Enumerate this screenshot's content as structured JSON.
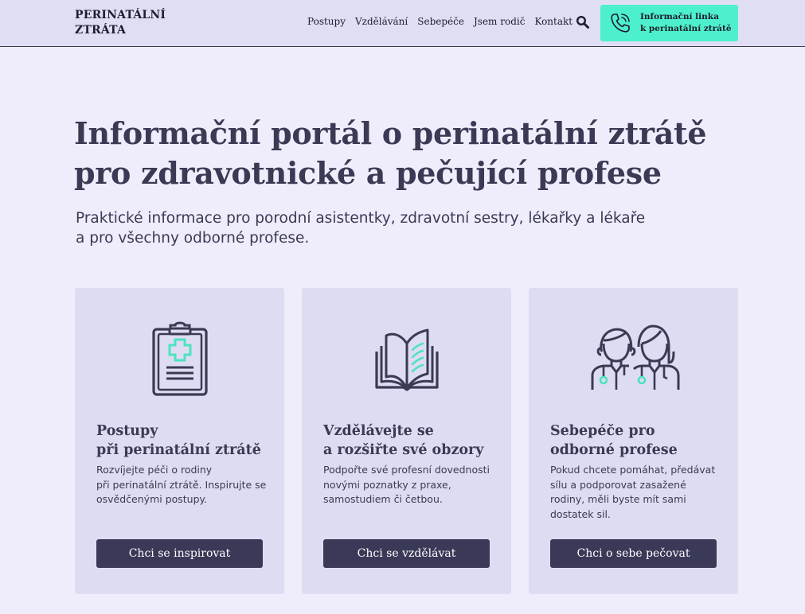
{
  "header": {
    "logo_line1": "PERINATÁLNÍ",
    "logo_line2": "ZTRÁTA",
    "nav": [
      "Postupy",
      "Vzdělávání",
      "Sebepéče",
      "Jsem rodič",
      "Kontakt"
    ],
    "search_icon": "search-icon",
    "helpline_icon": "phone-icon",
    "helpline_line1": "Informační linka",
    "helpline_line2": "k perinatální ztrátě"
  },
  "hero": {
    "title_line1": "Informační portál o perinatální ztrátě",
    "title_line2": "pro zdravotnické a pečující profese",
    "subtitle_line1": "Praktické informace pro porodní asistentky, zdravotní sestry, lékařky a lékaře",
    "subtitle_line2": "a pro všechny odborné profese."
  },
  "cards": [
    {
      "icon": "clipboard-icon",
      "title_line1": "Postupy",
      "title_line2": "při perinatální ztrátě",
      "text_lines": [
        "Rozvíjejte péči o rodiny",
        "při perinatální ztrátě. Inspirujte se",
        "osvědčenými postupy."
      ],
      "button": "Chci se inspirovat"
    },
    {
      "icon": "book-icon",
      "title_line1": "Vzdělávejte se",
      "title_line2": "a rozšiřte své obzory",
      "text_lines": [
        "Podpořte své profesní dovednosti",
        "novými poznatky z praxe,",
        "samostudiem či četbou."
      ],
      "button": "Chci se vzdělávat"
    },
    {
      "icon": "doctors-icon",
      "title_line1": "Sebepéče pro",
      "title_line2": "odborné profese",
      "text_lines": [
        "Pokud chcete pomáhat, předávat",
        "sílu a podporovat zasažené",
        "rodiny, měli byste mít sami",
        "dostatek sil."
      ],
      "button": "Chci o sebe pečovat"
    }
  ],
  "colors": {
    "background": "#efedfb",
    "header_bg": "#e0def3",
    "card_bg": "#dedcf2",
    "accent": "#4df0cc",
    "button_bg": "#3a3a58",
    "text": "#3a3a55"
  }
}
